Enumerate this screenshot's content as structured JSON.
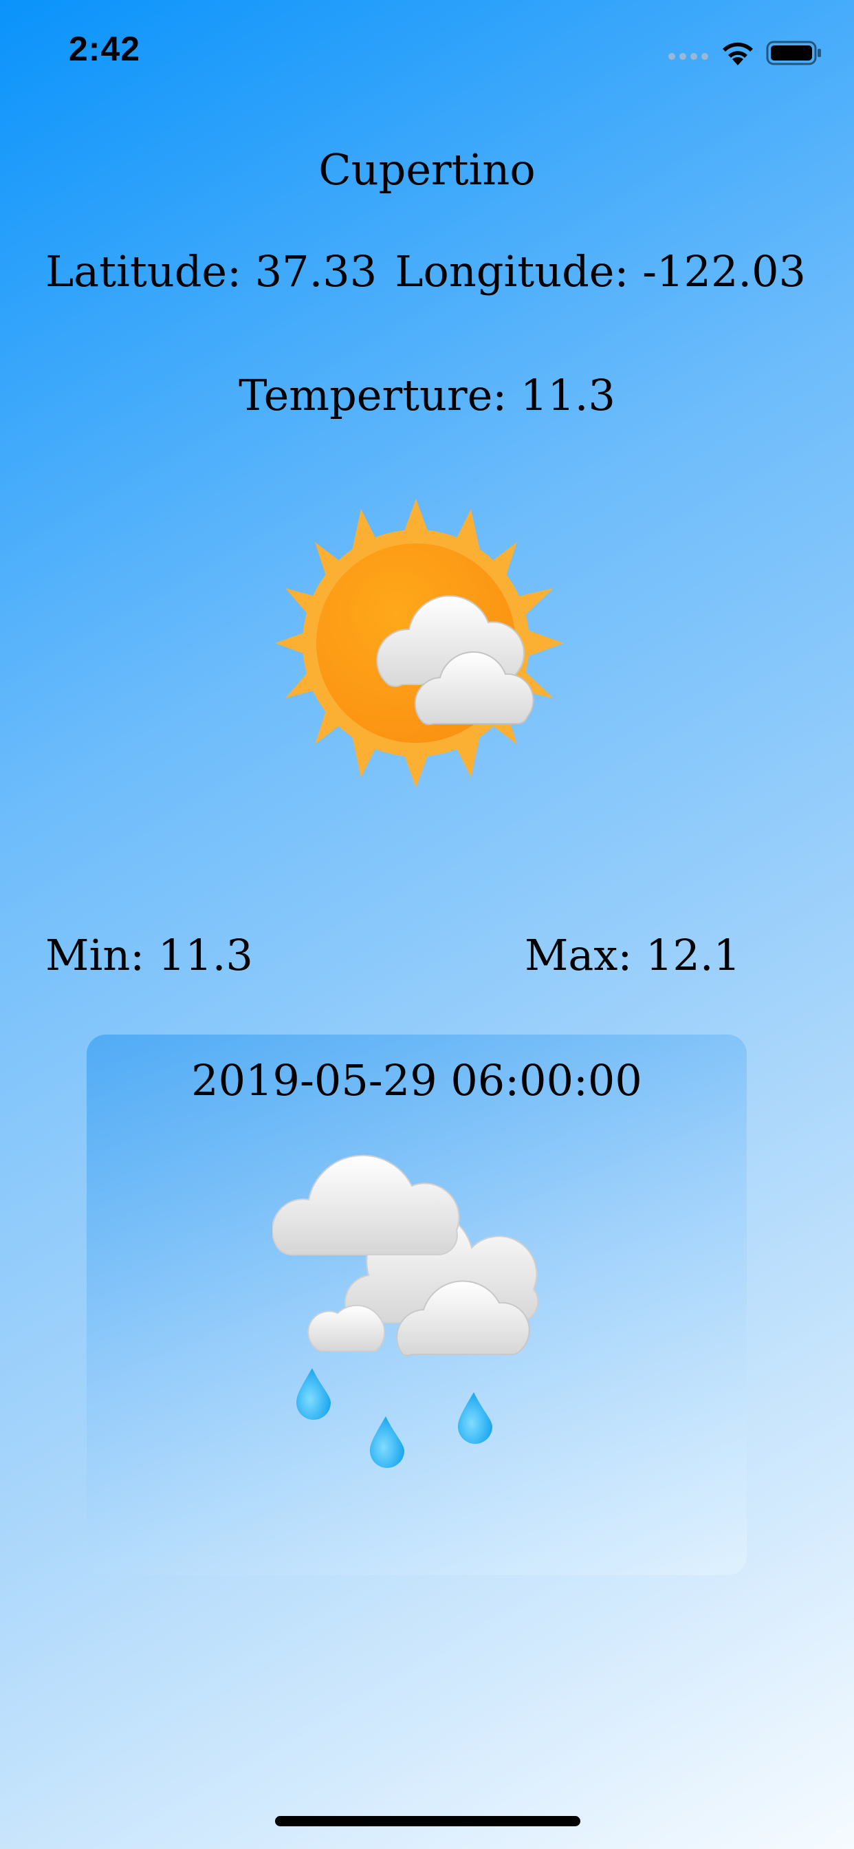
{
  "status_bar": {
    "time": "2:42",
    "icons": [
      "cellular-signal-icon",
      "wifi-icon",
      "battery-icon"
    ]
  },
  "location": {
    "city": "Cupertino",
    "latitude": "Latitude: 37.33",
    "longitude": "Longitude: -122.03"
  },
  "current": {
    "temperature": "Temperture: 11.3",
    "icon": "partly-cloudy-sun-icon",
    "min": "Min: 11.3",
    "max": "Max: 12.1"
  },
  "forecast": {
    "datetime": "2019-05-29 06:00:00",
    "icon": "rain-clouds-icon"
  },
  "colors": {
    "background_start": "#0a93fb",
    "background_end": "#f6fbff",
    "sun": "#fba21a",
    "raindrop": "#2ab2f5"
  }
}
